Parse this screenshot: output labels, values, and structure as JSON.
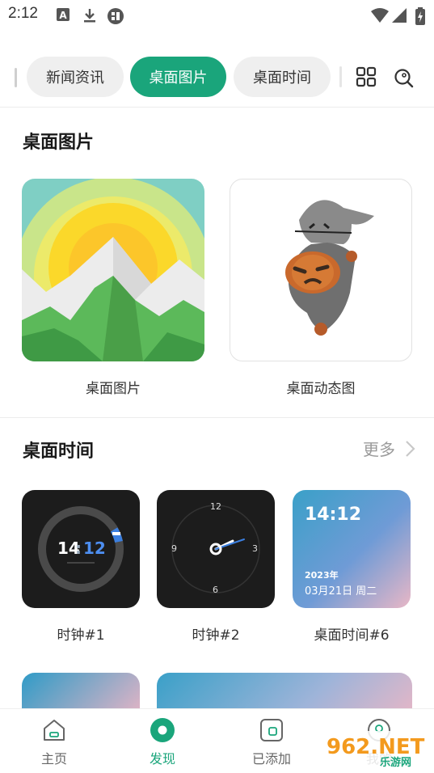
{
  "status_bar": {
    "time": "2:12"
  },
  "tabs": [
    {
      "label": "新闻资讯"
    },
    {
      "label": "桌面图片"
    },
    {
      "label": "桌面时间"
    }
  ],
  "section_pictures": {
    "title": "桌面图片",
    "items": [
      {
        "label": "桌面图片"
      },
      {
        "label": "桌面动态图"
      }
    ]
  },
  "section_time": {
    "title": "桌面时间",
    "more_label": "更多",
    "items": [
      {
        "label": "时钟#1",
        "time_hour": "14",
        "time_minute": "12"
      },
      {
        "label": "时钟#2",
        "dial": [
          "12",
          "3",
          "6",
          "9"
        ]
      },
      {
        "label": "桌面时间#6",
        "time": "14:12",
        "year": "2023年",
        "date": "03月21日 周二"
      }
    ]
  },
  "bottom_nav": [
    {
      "label": "主页"
    },
    {
      "label": "发现"
    },
    {
      "label": "已添加"
    },
    {
      "label": "我的"
    }
  ],
  "watermark": {
    "text": "962.NET",
    "sub": "乐游网"
  },
  "colors": {
    "accent": "#1aa57b",
    "tab_bg": "#efefef"
  }
}
